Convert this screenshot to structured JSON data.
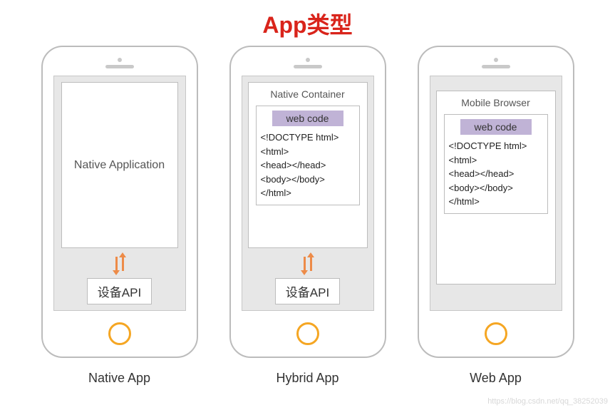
{
  "title": "App类型",
  "phones": {
    "native": {
      "box_label": "Native Application",
      "api_label": "设备API",
      "caption": "Native App"
    },
    "hybrid": {
      "container_title": "Native Container",
      "web_code_label": "web code",
      "code_lines": [
        "<!DOCTYPE html>",
        "<html>",
        "<head></head>",
        "<body></body>",
        "</html>"
      ],
      "api_label": "设备API",
      "caption": "Hybrid App"
    },
    "web": {
      "container_title": "Mobile Browser",
      "web_code_label": "web code",
      "code_lines": [
        "<!DOCTYPE html>",
        "<html>",
        "<head></head>",
        "<body></body>",
        "</html>"
      ],
      "caption": "Web App"
    }
  },
  "watermark": "https://blog.csdn.net/qq_38252039"
}
